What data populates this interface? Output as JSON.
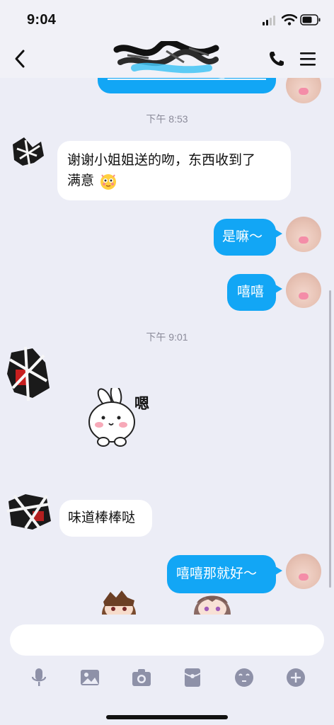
{
  "status": {
    "time": "9:04"
  },
  "nav": {
    "title_obscured": true
  },
  "messages": {
    "top_partial_link": "",
    "time1": "下午 8:53",
    "m1": "谢谢小姐姐送的吻，东西收到了满意",
    "m1_line1": "谢谢小姐姐送的吻，东西收到了",
    "m1_line2": "满意",
    "m2": "是嘛～",
    "m3": "嘻嘻",
    "time2": "下午 9:01",
    "sticker_text": "嗯",
    "m4": "味道棒棒哒",
    "m5": "嘻嘻那就好～"
  },
  "input": {
    "placeholder": ""
  },
  "toolbar": {
    "icons": [
      "microphone-icon",
      "image-icon",
      "camera-icon",
      "red-packet-icon",
      "emoji-icon",
      "plus-icon"
    ]
  },
  "colors": {
    "accent": "#12a6f5",
    "icon_gray": "#8e91a8",
    "background": "#ecedf6"
  }
}
